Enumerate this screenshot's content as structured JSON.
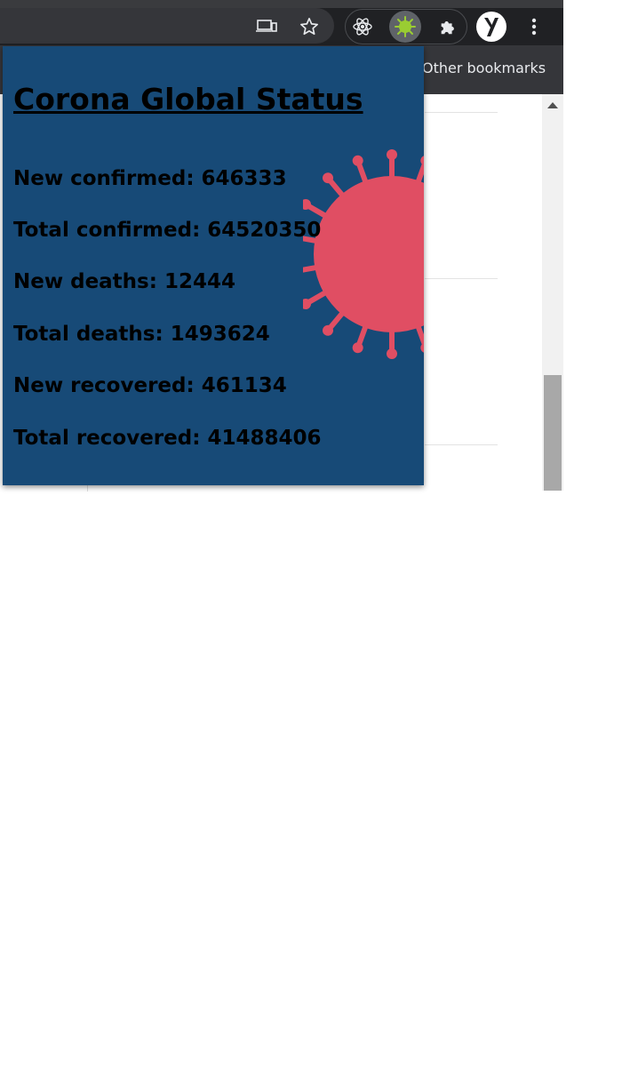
{
  "browser": {
    "bookmarks": {
      "other_label": "Other bookmarks"
    },
    "toolbar": {
      "icons": [
        "cast-icon",
        "star-icon",
        "react-devtools-icon",
        "covid-extension-icon",
        "puzzle-icon",
        "y-profile-icon",
        "kebab-menu-icon"
      ],
      "active_extension_color": "#9acd32"
    }
  },
  "popup": {
    "title": "Corona Global Status",
    "background": "#174a77",
    "virus_color": "#e04e63",
    "stats": [
      {
        "label": "New confirmed:",
        "value": "646333"
      },
      {
        "label": "Total confirmed:",
        "value": "64520350"
      },
      {
        "label": "New deaths:",
        "value": "12444"
      },
      {
        "label": "Total deaths:",
        "value": "1493624"
      },
      {
        "label": "New recovered:",
        "value": "461134"
      },
      {
        "label": "Total recovered:",
        "value": "41488406"
      }
    ]
  }
}
